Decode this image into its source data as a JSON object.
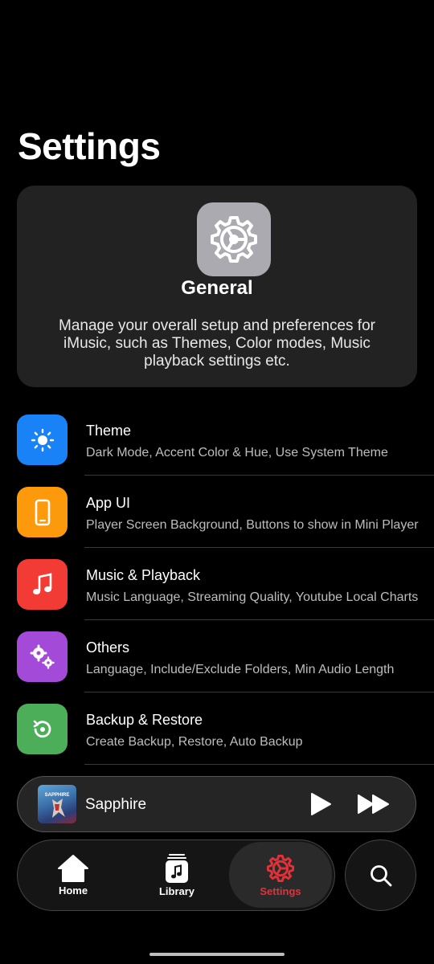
{
  "page": {
    "title": "Settings"
  },
  "general": {
    "title": "General",
    "description": "Manage your overall setup and preferences for iMusic, such as Themes, Color modes, Music playback settings etc.",
    "icon": "gear-icon"
  },
  "settings": [
    {
      "title": "Theme",
      "subtitle": "Dark Mode, Accent Color & Hue, Use System Theme",
      "icon": "sun-icon",
      "color": "#1a82f7"
    },
    {
      "title": "App UI",
      "subtitle": "Player Screen Background, Buttons to show in Mini Player",
      "icon": "phone-icon",
      "color": "#fd9a0b"
    },
    {
      "title": "Music & Playback",
      "subtitle": "Music Language, Streaming Quality, Youtube Local Charts",
      "icon": "music-note-icon",
      "color": "#f33b35"
    },
    {
      "title": "Others",
      "subtitle": "Language, Include/Exclude Folders, Min Audio Length",
      "icon": "gears-icon",
      "color": "#a44ad8"
    },
    {
      "title": "Backup & Restore",
      "subtitle": "Create Backup, Restore, Auto Backup",
      "icon": "restore-icon",
      "color": "#4cae58"
    }
  ],
  "mini_player": {
    "track_title": "Sapphire",
    "artwork_text": "SAPPHIRE"
  },
  "nav": {
    "home": "Home",
    "library": "Library",
    "settings": "Settings",
    "accent_color": "#e3313a"
  }
}
